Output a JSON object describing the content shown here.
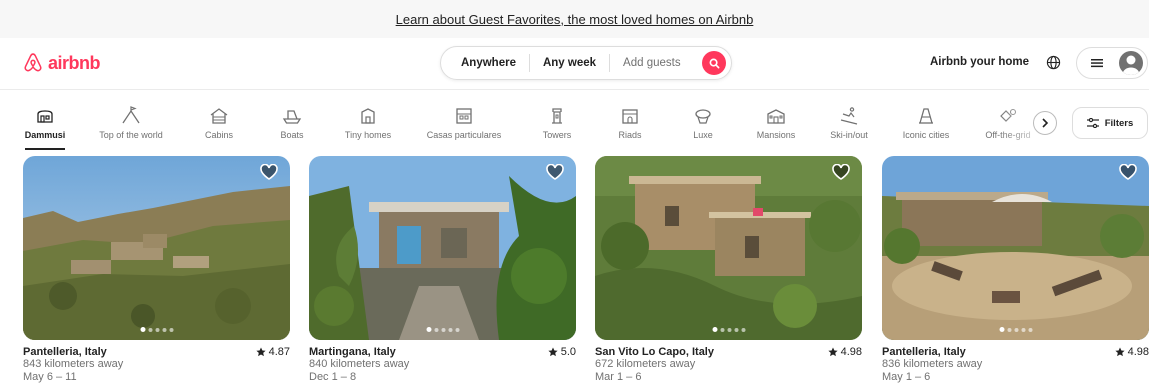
{
  "banner": {
    "text": "Learn about Guest Favorites, the most loved homes on Airbnb"
  },
  "header": {
    "logo_text": "airbnb",
    "search": {
      "where": "Anywhere",
      "when": "Any week",
      "who_placeholder": "Add guests"
    },
    "host_link": "Airbnb your home"
  },
  "categories": [
    {
      "label": "Dammusi",
      "icon": "dammusi-icon",
      "active": true
    },
    {
      "label": "Top of the world",
      "icon": "mountain-peak-icon"
    },
    {
      "label": "Cabins",
      "icon": "cabin-icon"
    },
    {
      "label": "Boats",
      "icon": "boat-icon"
    },
    {
      "label": "Tiny homes",
      "icon": "tiny-home-icon"
    },
    {
      "label": "Casas particulares",
      "icon": "casa-particular-icon"
    },
    {
      "label": "Towers",
      "icon": "tower-icon"
    },
    {
      "label": "Riads",
      "icon": "riad-icon"
    },
    {
      "label": "Luxe",
      "icon": "luxe-icon"
    },
    {
      "label": "Mansions",
      "icon": "mansion-icon"
    },
    {
      "label": "Ski-in/out",
      "icon": "skiing-icon"
    },
    {
      "label": "Iconic cities",
      "icon": "iconic-city-icon"
    },
    {
      "label": "Off-the-grid",
      "icon": "off-the-grid-icon"
    }
  ],
  "filters_label": "Filters",
  "listings": [
    {
      "title": "Pantelleria, Italy",
      "rating": "4.87",
      "distance": "843 kilometers away",
      "dates": "May 6 – 11"
    },
    {
      "title": "Martingana, Italy",
      "rating": "5.0",
      "distance": "840 kilometers away",
      "dates": "Dec 1 – 8"
    },
    {
      "title": "San Vito Lo Capo, Italy",
      "rating": "4.98",
      "distance": "672 kilometers away",
      "dates": "Mar 1 – 6"
    },
    {
      "title": "Pantelleria, Italy",
      "rating": "4.98",
      "distance": "836 kilometers away",
      "dates": "May 1 – 6"
    }
  ],
  "colors": {
    "brand": "#ff385c",
    "text": "#222222",
    "muted": "#717171"
  }
}
